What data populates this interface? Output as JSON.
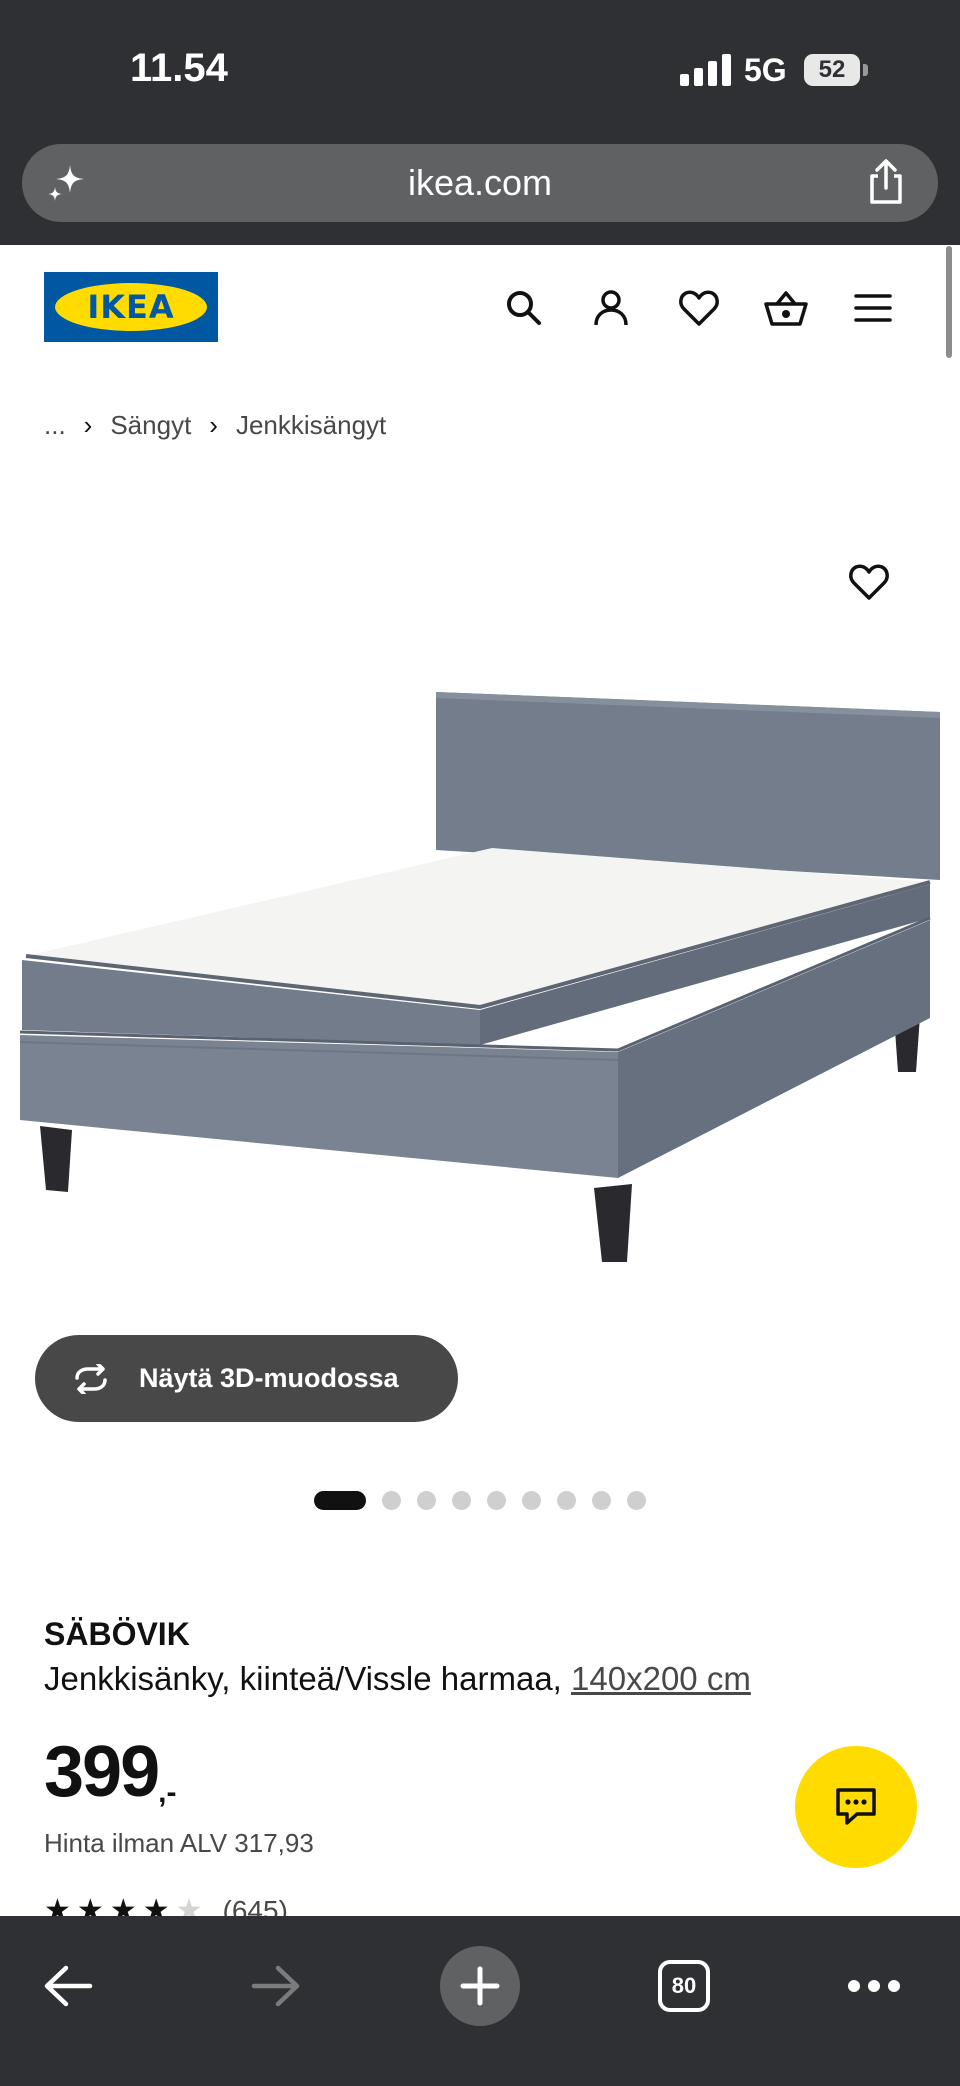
{
  "status_bar": {
    "time": "11.54",
    "network": "5G",
    "battery": "52"
  },
  "browser": {
    "url": "ikea.com",
    "tabs_count": "80"
  },
  "brand": {
    "logo_text": "IKEA",
    "blue": "#0058a3",
    "yellow": "#ffdb00"
  },
  "header_icons": [
    "search-icon",
    "account-icon",
    "favourites-icon",
    "basket-icon",
    "menu-icon"
  ],
  "breadcrumb": {
    "items": [
      "...",
      "Sängyt",
      "Jenkkisängyt"
    ]
  },
  "gallery": {
    "view_3d_label": "Näytä 3D-muodossa",
    "image_count": 9,
    "active_index": 0
  },
  "product": {
    "name": "SÄBÖVIK",
    "description": "Jenkkisänky, kiinteä/Vissle harmaa,",
    "size": "140x200 cm",
    "price": "399",
    "price_suffix": ",-",
    "price_ex_vat": "Hinta ilman ALV 317,93",
    "rating": 4,
    "rating_max": 5,
    "review_count": "(645)"
  }
}
